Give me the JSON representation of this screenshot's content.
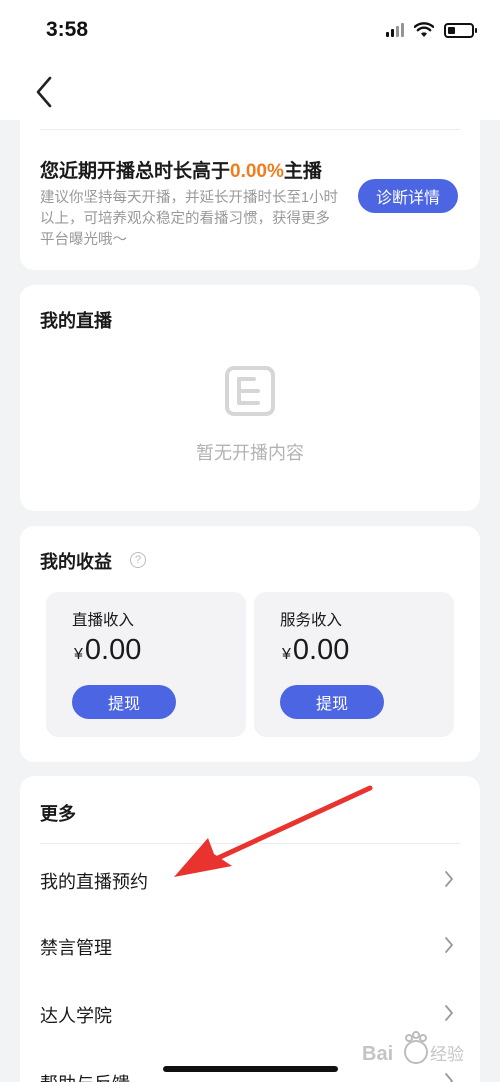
{
  "status_bar": {
    "time": "3:58"
  },
  "diagnosis": {
    "title_prefix": "您近期开播总时长高于",
    "percent": "0.00%",
    "title_suffix": "主播",
    "description": "建议你坚持每天开播，并延长开播时长至1小时以上，可培养观众稳定的看播习惯，获得更多平台曝光哦～",
    "button_label": "诊断详情"
  },
  "my_live": {
    "title": "我的直播",
    "empty_text": "暂无开播内容"
  },
  "income": {
    "title": "我的收益",
    "help_symbol": "?",
    "boxes": [
      {
        "label": "直播收入",
        "currency": "¥",
        "amount": "0.00",
        "button_label": "提现"
      },
      {
        "label": "服务收入",
        "currency": "¥",
        "amount": "0.00",
        "button_label": "提现"
      }
    ]
  },
  "more": {
    "title": "更多",
    "items": [
      {
        "label": "我的直播预约"
      },
      {
        "label": "禁言管理"
      },
      {
        "label": "达人学院"
      },
      {
        "label": "帮助与反馈"
      }
    ]
  },
  "colors": {
    "accent_blue": "#4c66e3",
    "highlight_orange": "#f07d1e",
    "annotation_red": "#e8332f"
  },
  "watermark_text": "Bai经验"
}
